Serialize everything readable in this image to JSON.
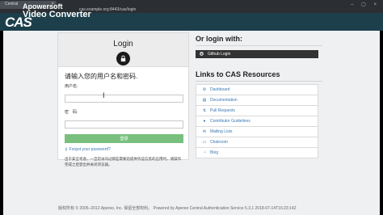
{
  "browser": {
    "tab_title": "Central",
    "url": "cas.example.org:8443/cas/login"
  },
  "watermark": {
    "line1": "Apowersoft",
    "line2": "Video Converter"
  },
  "header": {
    "logo": "CAS"
  },
  "login": {
    "title": "Login",
    "prompt": "请输入您的用户名和密码.",
    "username_label": "用户名:",
    "password_label": "密　码:",
    "submit_label": "登录",
    "forgot_label": "Forgot your password?",
    "notice": "出于安全考虑，一旦您访问过那些需要您提供凭证信息的应用时，请操作完成之后登出并关闭浏览器。"
  },
  "alt_login": {
    "title": "Or login with:",
    "github_label": "Github Login"
  },
  "links": {
    "title": "Links to CAS Resources",
    "items": [
      {
        "label": "Dashboard",
        "icon": "gear-icon"
      },
      {
        "label": "Documentation",
        "icon": "book-icon"
      },
      {
        "label": "Pull Requests",
        "icon": "pull-request-icon"
      },
      {
        "label": "Contributor Guidelines",
        "icon": "user-icon"
      },
      {
        "label": "Mailing Lists",
        "icon": "envelope-icon"
      },
      {
        "label": "Chatroom",
        "icon": "chat-icon"
      },
      {
        "label": "Blog",
        "icon": "rss-icon"
      }
    ]
  },
  "footer": {
    "text": "版权所有 © 2005–2012 Apereo, Inc. 保留全部权利。 Powered by Apereo Central Authentication Service 5.3.1 2018-07-14T16:23:14Z"
  }
}
